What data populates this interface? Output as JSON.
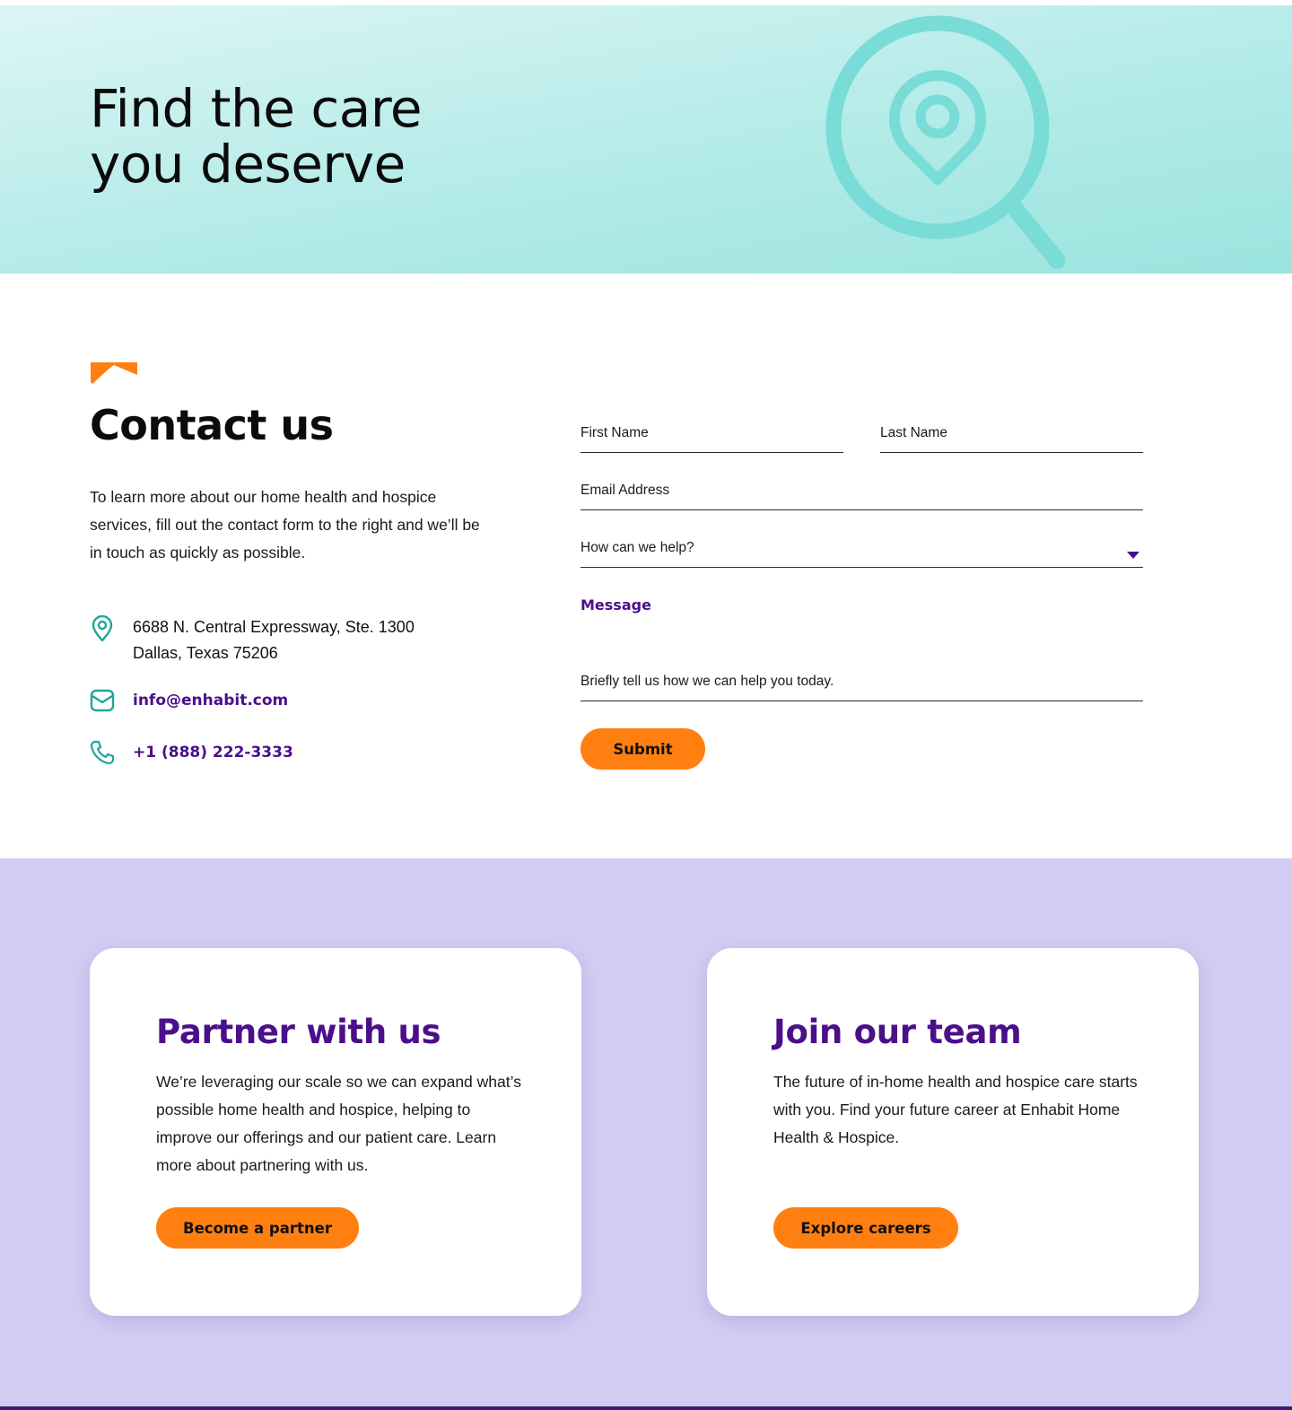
{
  "hero": {
    "title": "Find the care\nyou deserve",
    "icon": "map-search-icon"
  },
  "contact": {
    "title": "Contact us",
    "intro": "To learn more about our home health and hospice services, fill out the contact form to the right and we’ll be in touch as quickly as possible.",
    "address_line1": "6688 N. Central Expressway, Ste. 1300",
    "address_line2": "Dallas, Texas 75206",
    "email": "info@enhabit.com",
    "phone": "+1 (888) 222-3333",
    "icons": [
      "location-pin-icon",
      "mail-icon",
      "phone-icon"
    ]
  },
  "form": {
    "first_name_label": "First Name",
    "last_name_label": "Last Name",
    "email_label": "Email Address",
    "help_label": "How can we help?",
    "message_label": "Message",
    "message_placeholder": "Briefly tell us how we can help you today.",
    "submit_label": "Submit"
  },
  "cards": [
    {
      "title": "Partner with us",
      "text": "We’re leveraging our scale so we can expand what’s possible home health and hospice, helping to improve our offerings and our patient care. Learn more about partnering with us.",
      "button": "Become a partner"
    },
    {
      "title": "Join our team",
      "text": "The future of in-home health and hospice care starts with you. Find your future career at Enhabit Home Health & Hospice.",
      "button": "Explore careers"
    }
  ],
  "colors": {
    "brand_purple": "#4b0f8a",
    "brand_orange": "#ff7f11",
    "teal_accent": "#1fa59b",
    "hero_teal": "#9be4df",
    "cards_background": "#d0ccf2"
  }
}
